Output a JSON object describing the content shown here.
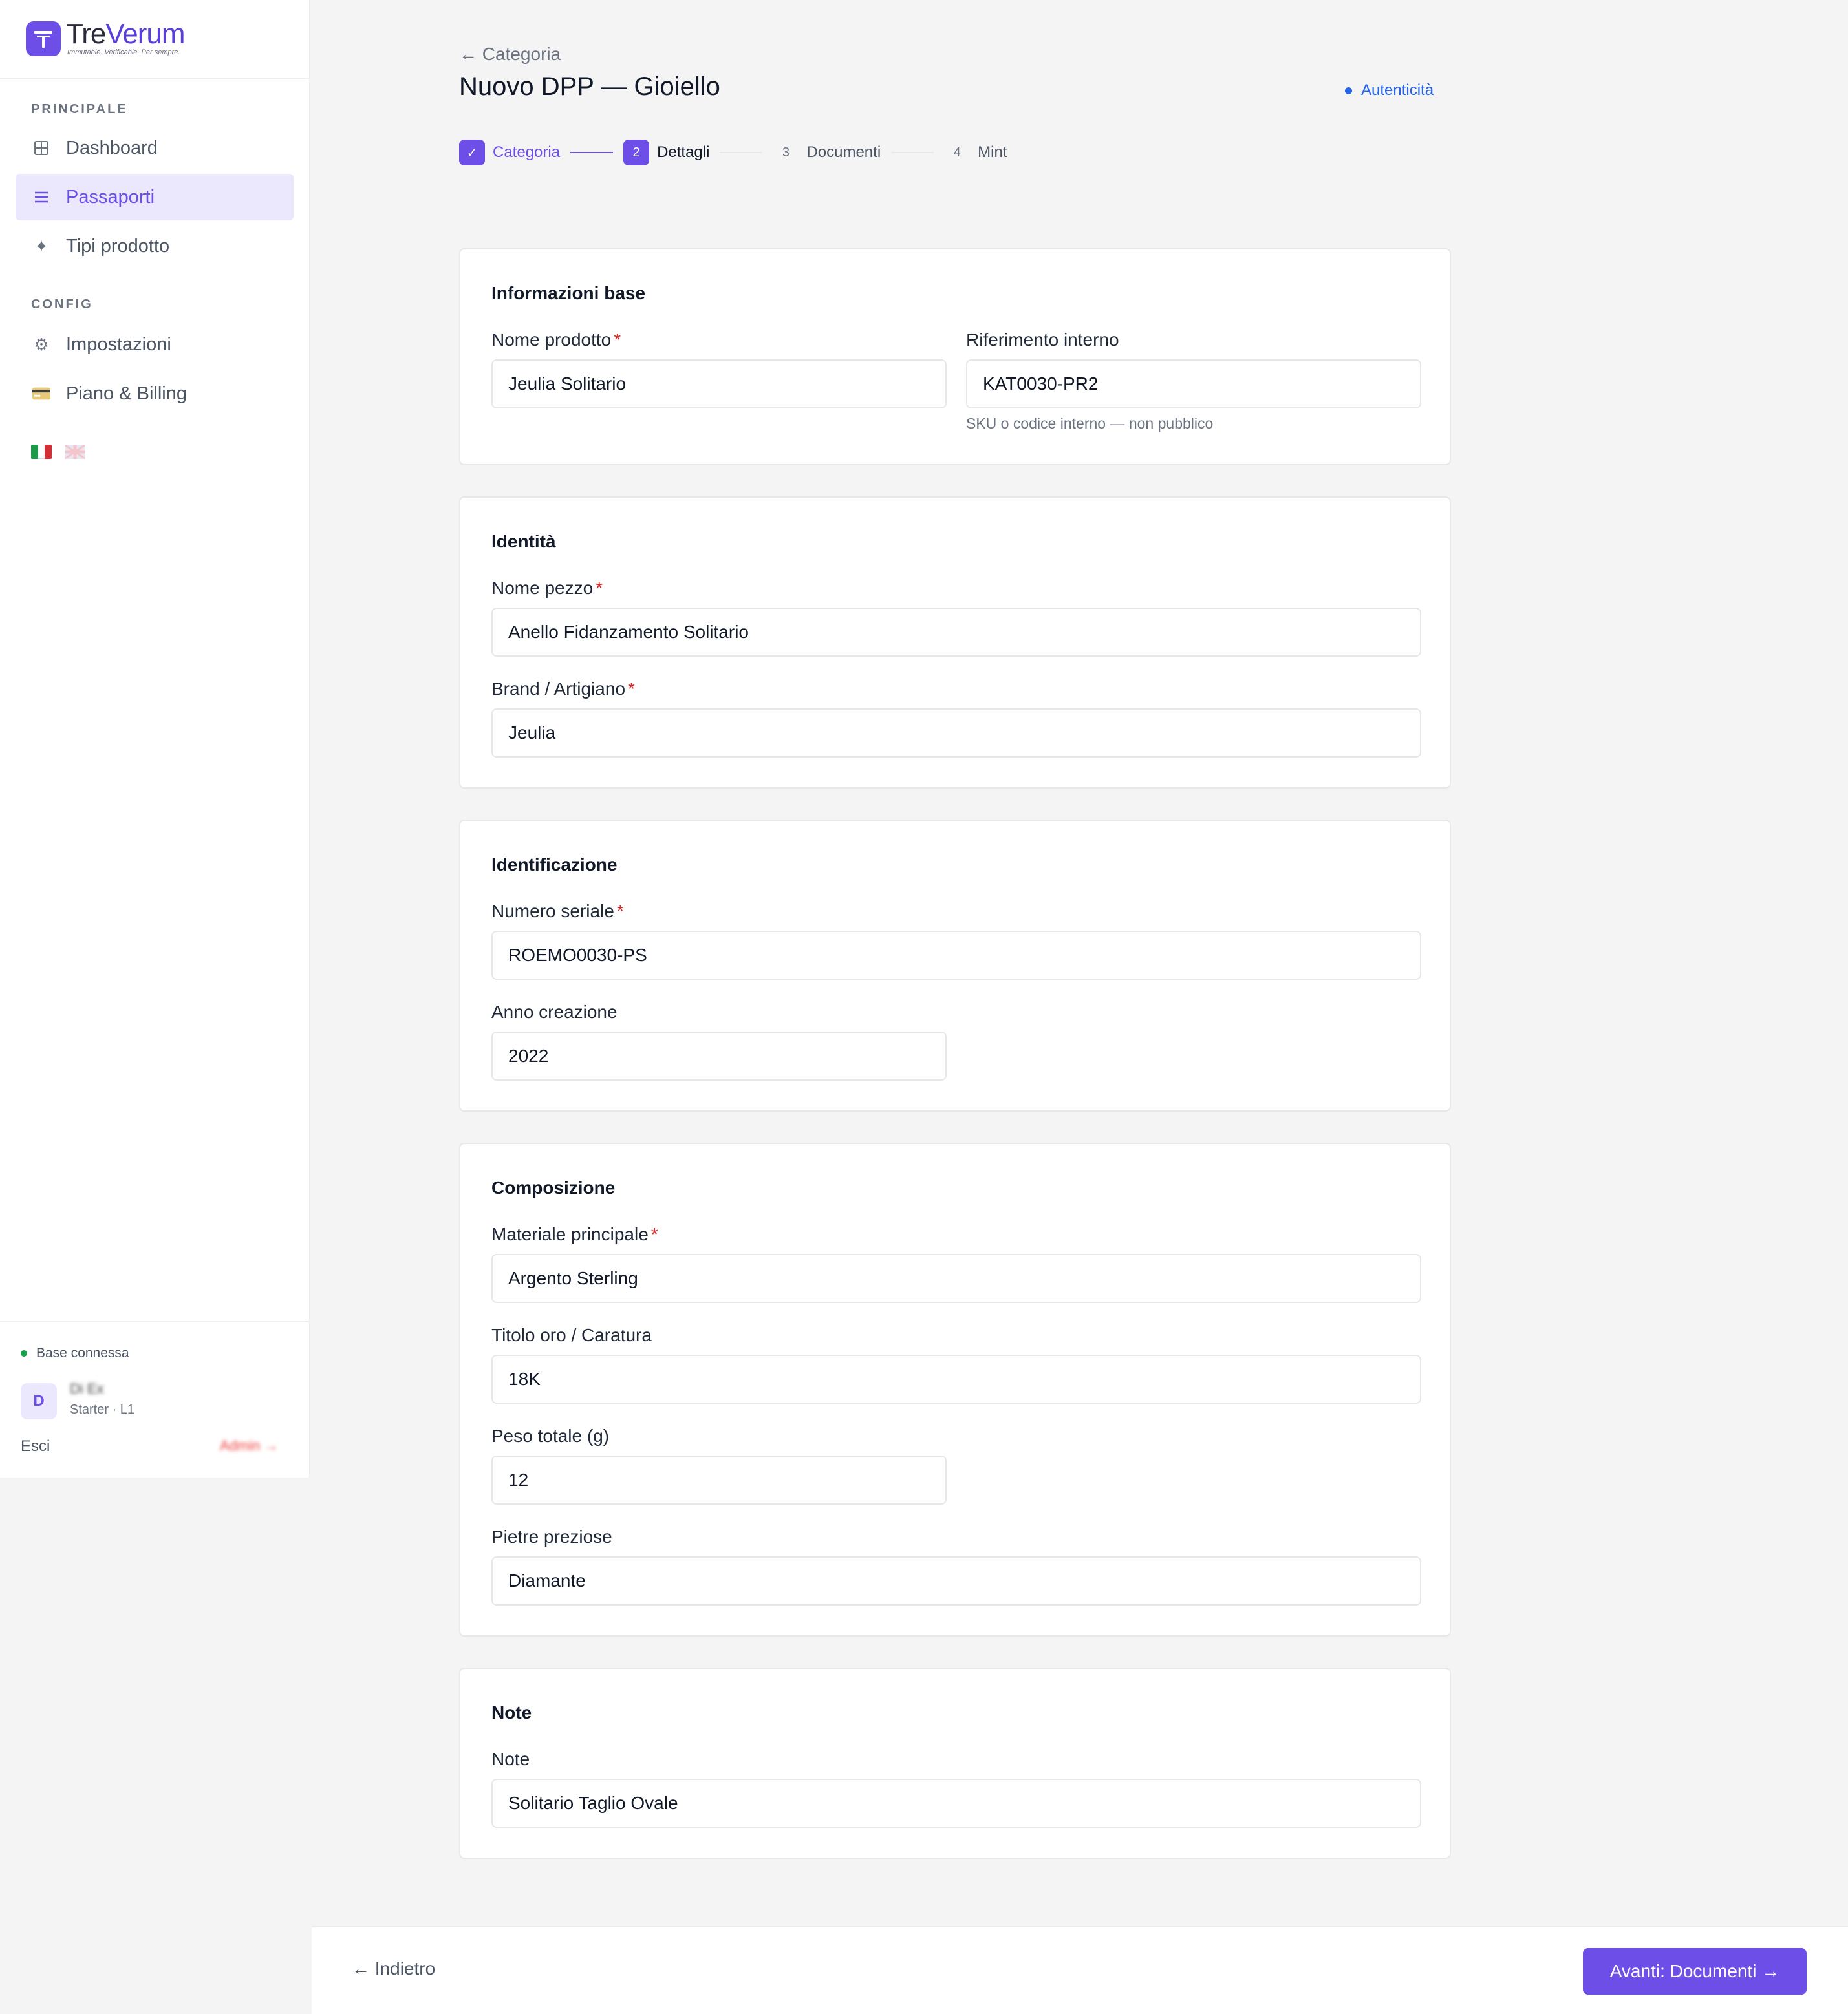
{
  "brand": {
    "name_first": "Tre",
    "name_second": "Verum",
    "tagline": "Immutable. Verificable. Per sempre.",
    "accent": "#6d4ee6"
  },
  "sidebar": {
    "section_main": "PRINCIPALE",
    "section_config": "CONFIG",
    "items": [
      {
        "label": "Dashboard",
        "icon": "grid-icon",
        "active": false
      },
      {
        "label": "Passaporti",
        "icon": "list-icon",
        "active": true
      },
      {
        "label": "Tipi prodotto",
        "icon": "sparkle-icon",
        "active": false
      },
      {
        "label": "Impostazioni",
        "icon": "gear-icon",
        "active": false
      },
      {
        "label": "Piano & Billing",
        "icon": "credit-card-icon",
        "active": false
      }
    ],
    "languages": [
      "it-flag-icon",
      "uk-flag-icon"
    ],
    "status": "Base connessa",
    "user": {
      "initial": "D",
      "name": "Di Ex",
      "plan": "Starter · L1"
    },
    "logout": "Esci",
    "admin": "Admin →"
  },
  "header": {
    "back": "← Categoria",
    "title": "Nuovo DPP — Gioiello",
    "auth_link": "Autenticità"
  },
  "stepper": {
    "steps": [
      {
        "badge": "✓",
        "label": "Categoria",
        "state": "done"
      },
      {
        "badge": "2",
        "label": "Dettagli",
        "state": "current"
      },
      {
        "badge": "3",
        "label": "Documenti",
        "state": "todo"
      },
      {
        "badge": "4",
        "label": "Mint",
        "state": "todo"
      }
    ]
  },
  "sections": {
    "base": {
      "title": "Informazioni base",
      "nome_prodotto": {
        "label": "Nome prodotto",
        "value": "Jeulia Solitario"
      },
      "riferimento": {
        "label": "Riferimento interno",
        "value": "KAT0030-PR2",
        "hint": "SKU o codice interno — non pubblico"
      }
    },
    "identita": {
      "title": "Identità",
      "nome_pezzo": {
        "label": "Nome pezzo",
        "value": "Anello Fidanzamento Solitario"
      },
      "brand": {
        "label": "Brand / Artigiano",
        "value": "Jeulia"
      }
    },
    "identificazione": {
      "title": "Identificazione",
      "seriale": {
        "label": "Numero seriale",
        "value": "ROEMO0030-PS"
      },
      "anno": {
        "label": "Anno creazione",
        "value": "2022"
      }
    },
    "composizione": {
      "title": "Composizione",
      "materiale": {
        "label": "Materiale principale",
        "value": "Argento Sterling"
      },
      "titolo": {
        "label": "Titolo oro / Caratura",
        "value": "18K"
      },
      "peso": {
        "label": "Peso totale (g)",
        "value": "12"
      },
      "pietre": {
        "label": "Pietre preziose",
        "value": "Diamante"
      }
    },
    "note": {
      "title": "Note",
      "note": {
        "label": "Note",
        "value": "Solitario Taglio Ovale"
      }
    }
  },
  "required_mark": "*",
  "footer": {
    "back": "← Indietro",
    "next": "Avanti: Documenti →"
  }
}
